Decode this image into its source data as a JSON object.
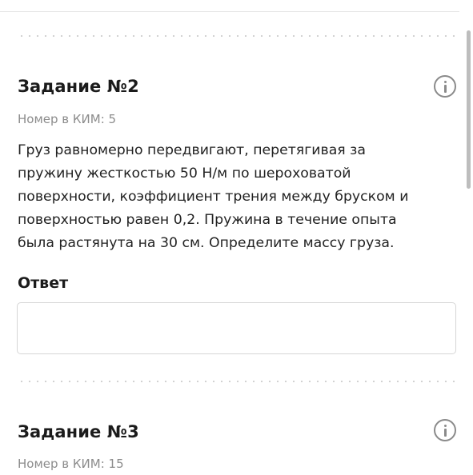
{
  "task2": {
    "title": "Задание №2",
    "kim": "Номер в КИМ: 5",
    "text": "Груз равномерно передвигают, перетягивая за пружину жесткостью 50 Н/м по шероховатой поверхности, коэффициент трения между бруском и поверхностью равен 0,2. Пружина в течение опыта была растянута на 30 см. Определите массу груза.",
    "answer_label": "Ответ",
    "answer_value": "",
    "answer_placeholder": ""
  },
  "task3": {
    "title": "Задание №3",
    "kim": "Номер в КИМ: 15"
  },
  "icons": {
    "info": "info-icon"
  }
}
